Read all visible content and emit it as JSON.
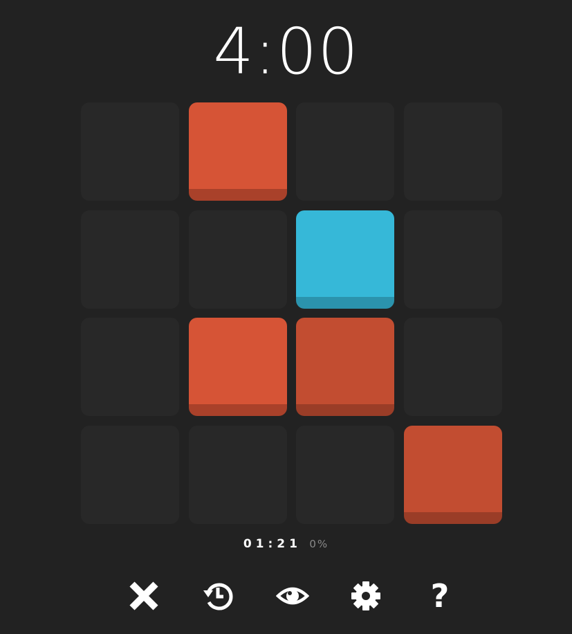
{
  "timer": "4:00",
  "colors": {
    "background": "#222222",
    "empty_tile": "#282828",
    "red": "#d65436",
    "red_base": "#a9412a",
    "dark_red": "#c24d31",
    "dark_red_base": "#9a3d27",
    "blue": "#36b8d8",
    "blue_base": "#2b93ad"
  },
  "board": {
    "rows": 4,
    "cols": 4,
    "cells": [
      [
        "empty",
        "red",
        "empty",
        "empty"
      ],
      [
        "empty",
        "empty",
        "blue",
        "empty"
      ],
      [
        "empty",
        "red",
        "dark_red",
        "empty"
      ],
      [
        "empty",
        "empty",
        "empty",
        "dark_red"
      ]
    ]
  },
  "status": {
    "elapsed": "01:21",
    "progress": "0%"
  },
  "toolbar": [
    {
      "icon": "close-icon"
    },
    {
      "icon": "history-icon"
    },
    {
      "icon": "eye-icon"
    },
    {
      "icon": "gear-icon"
    },
    {
      "icon": "help-icon",
      "label": "?"
    }
  ]
}
